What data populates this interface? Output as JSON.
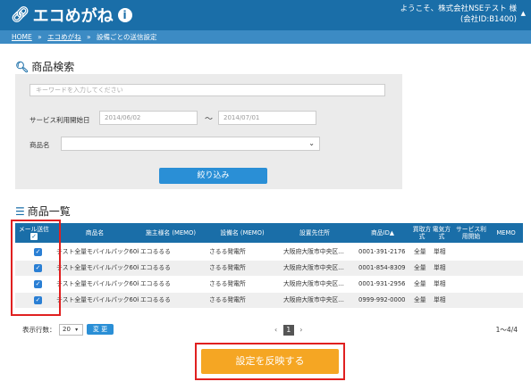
{
  "header": {
    "logo_text": "エコめがね",
    "welcome_line1": "ようこそ、株式会社NSEテスト 様",
    "welcome_line2": "(会社ID:B1400)"
  },
  "breadcrumb": {
    "home": "HOME",
    "section": "エコめがね",
    "current": "設備ごとの送信設定",
    "separator": "»"
  },
  "search": {
    "title": "商品検索",
    "keyword_placeholder": "キーワードを入力してください",
    "start_date_label": "サービス利用開始日",
    "date_from_placeholder": "2014/06/02",
    "date_to_placeholder": "2014/07/01",
    "tilde": "〜",
    "product_label": "商品名",
    "filter_button": "絞り込み"
  },
  "list": {
    "title": "商品一覧",
    "columns": {
      "mail": "メール送信",
      "product": "商品名",
      "owner": "施主様名 (MEMO)",
      "equipment": "設備名 (MEMO)",
      "address": "設置先住所",
      "product_id": "商品ID▲",
      "buy": "買取方式",
      "elec": "電気方式",
      "service": "サービス利用開始",
      "memo": "MEMO"
    },
    "rows": [
      {
        "product": "テスト全量モバイルパック60k",
        "owner": "エコるるる",
        "equipment": "さるる発電所",
        "address": "大阪府大阪市中央区…",
        "product_id": "0001-391-2176",
        "buy": "全量",
        "elec": "単相",
        "checked": true
      },
      {
        "product": "テスト全量モバイルパック60k",
        "owner": "エコるるる",
        "equipment": "さるる発電所",
        "address": "大阪府大阪市中央区…",
        "product_id": "0001-854-8309",
        "buy": "全量",
        "elec": "単相",
        "checked": true
      },
      {
        "product": "テスト全量モバイルパック60k",
        "owner": "エコるるる",
        "equipment": "さるる発電所",
        "address": "大阪府大阪市中央区…",
        "product_id": "0001-931-2956",
        "buy": "全量",
        "elec": "単相",
        "checked": true
      },
      {
        "product": "テスト全量モバイルパック60k",
        "owner": "エコるるる",
        "equipment": "さるる発電所",
        "address": "大阪府大阪市中央区…",
        "product_id": "0999-992-0000",
        "buy": "全量",
        "elec": "単相",
        "checked": true
      }
    ]
  },
  "pagination": {
    "rows_label": "表示行数：",
    "rows_value": "20",
    "change_button": "変 更",
    "prev": "‹",
    "current_page": "1",
    "next": "›",
    "count": "1〜4/4"
  },
  "apply_button": "設定を反映する",
  "colors": {
    "header": "#1a6ea8",
    "accent": "#2a8fd6",
    "apply": "#f5a623",
    "highlight": "#e02020"
  }
}
